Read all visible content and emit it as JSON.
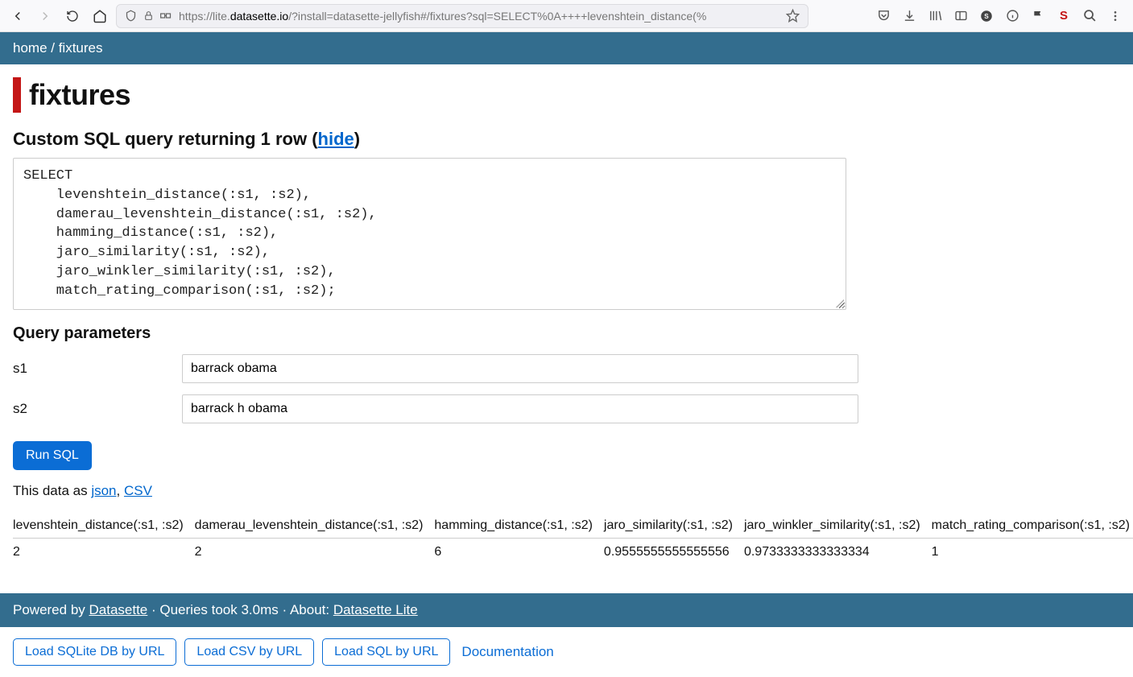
{
  "browser": {
    "url_prefix": "https://lite.",
    "url_domain": "datasette.io",
    "url_rest": "/?install=datasette-jellyfish#/fixtures?sql=SELECT%0A++++levenshtein_distance(%"
  },
  "header": {
    "home": "home",
    "separator": " / ",
    "current": "fixtures"
  },
  "page": {
    "title": "fixtures",
    "query_heading_prefix": "Custom SQL query returning 1 row (",
    "query_heading_link": "hide",
    "query_heading_suffix": ")",
    "sql": "SELECT\n    levenshtein_distance(:s1, :s2),\n    damerau_levenshtein_distance(:s1, :s2),\n    hamming_distance(:s1, :s2),\n    jaro_similarity(:s1, :s2),\n    jaro_winkler_similarity(:s1, :s2),\n    match_rating_comparison(:s1, :s2);",
    "params_heading": "Query parameters",
    "params": [
      {
        "label": "s1",
        "value": "barrack obama"
      },
      {
        "label": "s2",
        "value": "barrack h obama"
      }
    ],
    "run_label": "Run SQL",
    "data_as_prefix": "This data as ",
    "data_as_json": "json",
    "data_as_sep": ", ",
    "data_as_csv": "CSV"
  },
  "results": {
    "columns": [
      "levenshtein_distance(:s1, :s2)",
      "damerau_levenshtein_distance(:s1, :s2)",
      "hamming_distance(:s1, :s2)",
      "jaro_similarity(:s1, :s2)",
      "jaro_winkler_similarity(:s1, :s2)",
      "match_rating_comparison(:s1, :s2)"
    ],
    "rows": [
      [
        "2",
        "2",
        "6",
        "0.9555555555555556",
        "0.9733333333333334",
        "1"
      ]
    ]
  },
  "footer": {
    "prefix": "Powered by ",
    "datasette": "Datasette",
    "middle": " · Queries took 3.0ms · About: ",
    "about": "Datasette Lite"
  },
  "load": {
    "sqlite": "Load SQLite DB by URL",
    "csv": "Load CSV by URL",
    "sql": "Load SQL by URL",
    "docs": "Documentation"
  }
}
